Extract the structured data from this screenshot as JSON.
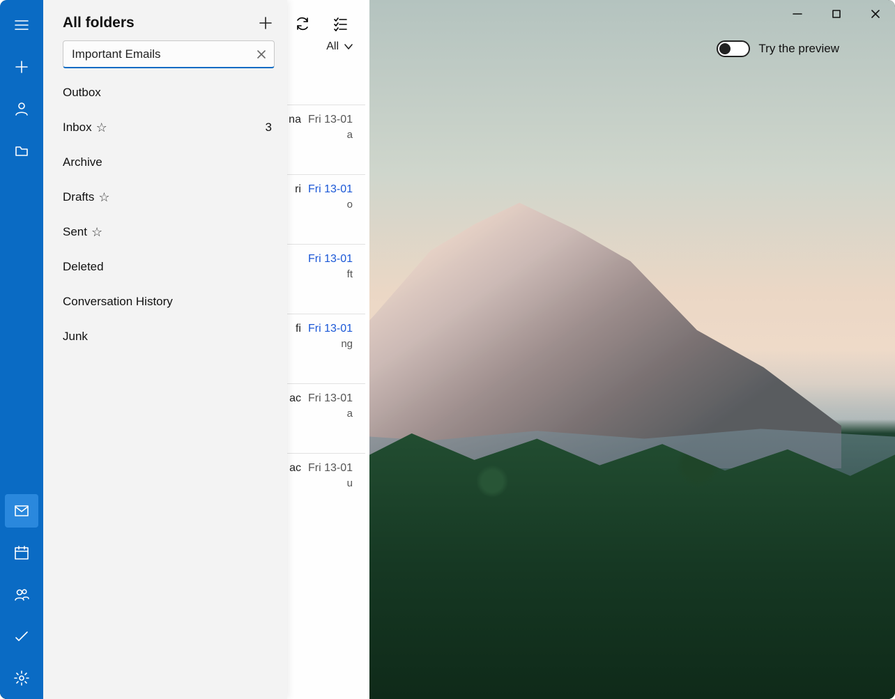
{
  "window": {
    "preview_label": "Try the preview"
  },
  "rail": {
    "items": [
      "menu",
      "compose",
      "account",
      "folder"
    ],
    "bottom_items": [
      "mail",
      "calendar",
      "people",
      "todo",
      "settings"
    ]
  },
  "folder_panel": {
    "title": "All folders",
    "search_value": "Important Emails",
    "items": [
      {
        "label": "Outbox",
        "starred": false,
        "count": ""
      },
      {
        "label": "Inbox",
        "starred": true,
        "count": "3"
      },
      {
        "label": "Archive",
        "starred": false,
        "count": ""
      },
      {
        "label": "Drafts",
        "starred": true,
        "count": ""
      },
      {
        "label": "Sent",
        "starred": true,
        "count": ""
      },
      {
        "label": "Deleted",
        "starred": false,
        "count": ""
      },
      {
        "label": "Conversation History",
        "starred": false,
        "count": ""
      },
      {
        "label": "Junk",
        "starred": false,
        "count": ""
      }
    ]
  },
  "messages": {
    "filter_label": "All",
    "items": [
      {
        "frag1": "na",
        "frag2": "a",
        "date": "Fri 13-01",
        "read": true
      },
      {
        "frag1": "ri",
        "frag2": "o",
        "date": "Fri 13-01",
        "read": false
      },
      {
        "frag1": "",
        "frag2": "ft",
        "date": "Fri 13-01",
        "read": false
      },
      {
        "frag1": "fi",
        "frag2": "ng",
        "date": "Fri 13-01",
        "read": false
      },
      {
        "frag1": "ac",
        "frag2": "a",
        "date": "Fri 13-01",
        "read": true
      },
      {
        "frag1": "ac",
        "frag2": "u",
        "date": "Fri 13-01",
        "read": true
      }
    ]
  }
}
